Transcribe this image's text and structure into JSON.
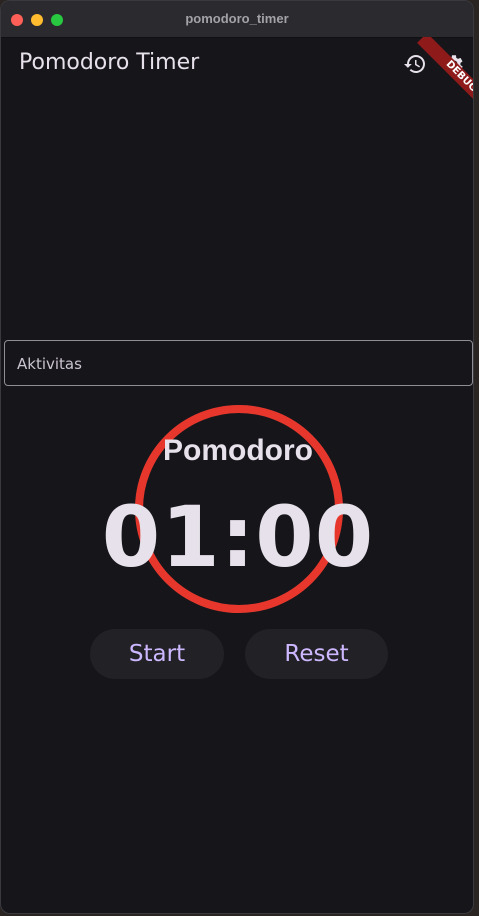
{
  "window": {
    "title": "pomodoro_timer"
  },
  "appbar": {
    "title": "Pomodoro Timer",
    "history_icon": "history-icon",
    "settings_icon": "settings-icon"
  },
  "debug": {
    "label": "DEBUG"
  },
  "activity": {
    "placeholder": "Aktivitas",
    "value": ""
  },
  "timer": {
    "mode": "Pomodoro",
    "time": "01:00",
    "ring_color": "#e7372c",
    "progress": 1.0
  },
  "controls": {
    "start_label": "Start",
    "reset_label": "Reset"
  },
  "colors": {
    "background": "#16151a",
    "accent": "#cdb8ff",
    "ring": "#e7372c"
  }
}
